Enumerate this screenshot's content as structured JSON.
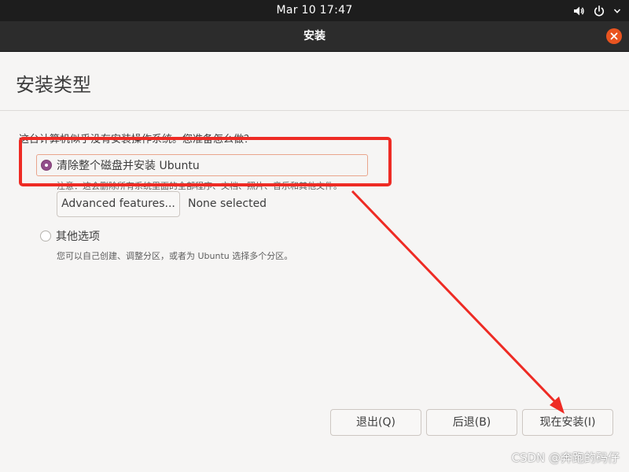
{
  "topbar": {
    "datetime": "Mar 10  17:47",
    "icons": [
      "volume-icon",
      "power-icon",
      "chevron-down-icon"
    ]
  },
  "window": {
    "title": "安装",
    "close_icon": "close-icon",
    "accent": "#e95420"
  },
  "page": {
    "heading": "安装类型",
    "question": "这台计算机似乎没有安装操作系统。您准备怎么做？",
    "options": [
      {
        "label": "清除整个磁盘并安装 Ubuntu",
        "selected": true,
        "note": "注意：这会删除所有系统里面的全部程序、文档、照片、音乐和其他文件。"
      },
      {
        "label": "其他选项",
        "selected": false,
        "note": "您可以自己创建、调整分区，或者为 Ubuntu 选择多个分区。"
      }
    ],
    "advanced_button": "Advanced features...",
    "advanced_status": "None selected"
  },
  "footer": {
    "quit": "退出(Q)",
    "back": "后退(B)",
    "install_now": "现在安装(I)"
  },
  "annotations": {
    "highlight_color": "#ee2b24",
    "watermark": "CSDN @奔跑的码仔"
  }
}
